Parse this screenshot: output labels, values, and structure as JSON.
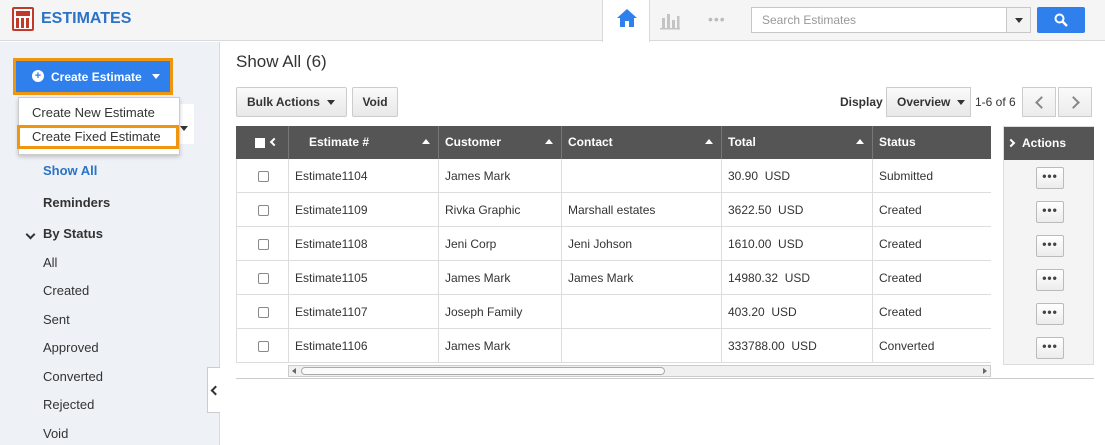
{
  "header": {
    "app_title": "ESTIMATES",
    "search_placeholder": "Search Estimates",
    "more_tab": "•••",
    "colors": {
      "accent": "#2f80ed",
      "title": "#2a73c5",
      "highlight": "#f0960e"
    }
  },
  "sidebar": {
    "create_button": "Create Estimate",
    "menu": [
      "Create New Estimate",
      "Create Fixed Estimate"
    ],
    "items": [
      {
        "label": "Show All"
      },
      {
        "label": "Reminders"
      },
      {
        "label": "By Status"
      },
      {
        "label": "All"
      },
      {
        "label": "Created"
      },
      {
        "label": "Sent"
      },
      {
        "label": "Approved"
      },
      {
        "label": "Converted"
      },
      {
        "label": "Rejected"
      },
      {
        "label": "Void"
      }
    ]
  },
  "main": {
    "title": "Show All (6)",
    "bulk_actions": "Bulk Actions",
    "void_button": "Void",
    "display_label": "Display",
    "display_value": "Overview",
    "pager": "1-6 of 6",
    "columns": [
      "Estimate #",
      "Customer",
      "Contact",
      "Total",
      "Status"
    ],
    "actions_header": "Actions",
    "action_glyph": "•••",
    "rows": [
      {
        "estimate": "Estimate1104",
        "customer": "James Mark",
        "contact": "",
        "total": "30.90  USD",
        "status": "Submitted"
      },
      {
        "estimate": "Estimate1109",
        "customer": "Rivka Graphic",
        "contact": "Marshall estates",
        "total": "3622.50  USD",
        "status": "Created"
      },
      {
        "estimate": "Estimate1108",
        "customer": "Jeni Corp",
        "contact": "Jeni Johson",
        "total": "1610.00  USD",
        "status": "Created"
      },
      {
        "estimate": "Estimate1105",
        "customer": "James Mark",
        "contact": "James Mark",
        "total": "14980.32  USD",
        "status": "Created"
      },
      {
        "estimate": "Estimate1107",
        "customer": "Joseph Family",
        "contact": "",
        "total": "403.20  USD",
        "status": "Created"
      },
      {
        "estimate": "Estimate1106",
        "customer": "James Mark",
        "contact": "",
        "total": "333788.00  USD",
        "status": "Converted"
      }
    ]
  }
}
